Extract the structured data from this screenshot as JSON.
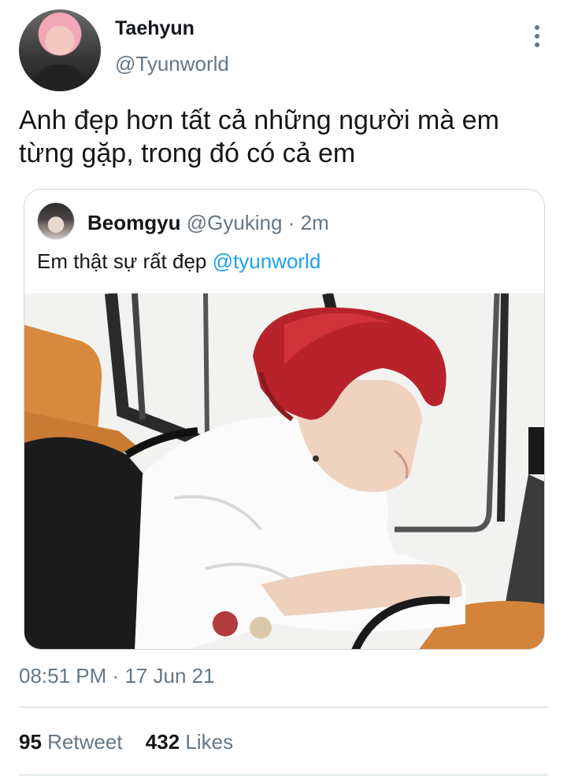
{
  "author": {
    "name": "Taehyun",
    "handle": "@Tyunworld"
  },
  "tweet": {
    "text_line1": "Anh đẹp hơn tất cả những người mà em",
    "text_line2": "từng gặp, trong đó có cả em"
  },
  "quoted_tweet": {
    "name": "Beomgyu",
    "handle": "@Gyuking",
    "separator": "·",
    "time": "2m",
    "text": "Em thật sự rất đẹp",
    "mention": "@tyunworld"
  },
  "meta": {
    "timestamp": "08:51 PM · 17 Jun 21"
  },
  "stats": {
    "retweets_count": "95",
    "retweets_label": "Retweet",
    "likes_count": "432",
    "likes_label": "Likes"
  },
  "icons": {
    "more": "more-vertical-icon"
  },
  "colors": {
    "link": "#1da1f2",
    "secondary_text": "#657786",
    "border": "#ccd6dd"
  }
}
